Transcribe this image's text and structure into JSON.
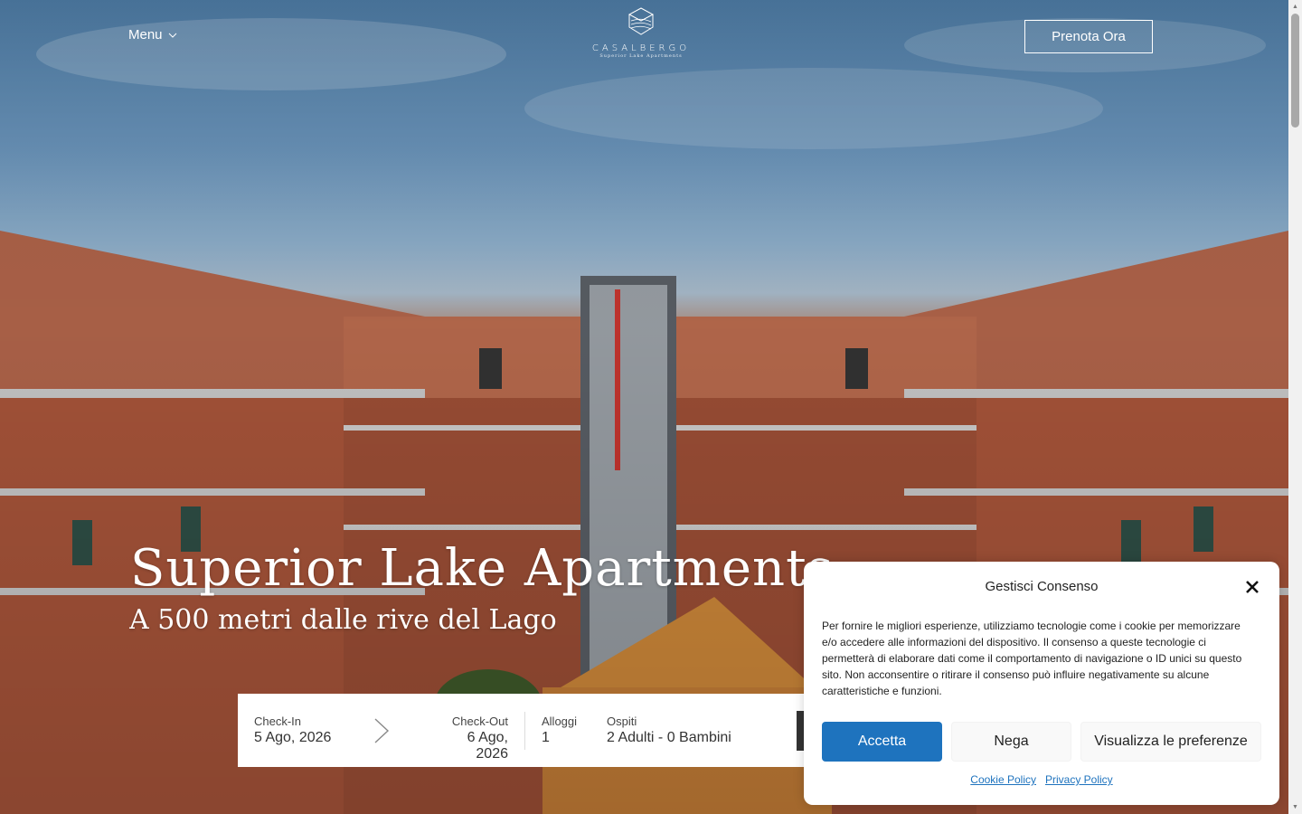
{
  "header": {
    "menu_label": "Menu",
    "logo_name": "CASALBERGO",
    "logo_tagline": "Superior Lake Apartments",
    "book_label": "Prenota Ora"
  },
  "hero": {
    "title": "Superior Lake Apartments",
    "subtitle": "A 500 metri dalle rive del Lago"
  },
  "booking": {
    "checkin_label": "Check-In",
    "checkin_value": "5 Ago, 2026",
    "checkout_label": "Check-Out",
    "checkout_value": "6 Ago, 2026",
    "rooms_label": "Alloggi",
    "rooms_value": "1",
    "guests_label": "Ospiti",
    "guests_value": "2 Adulti - 0 Bambini"
  },
  "cookie_dialog": {
    "title": "Gestisci Consenso",
    "body": "Per fornire le migliori esperienze, utilizziamo tecnologie come i cookie per memorizzare e/o accedere alle informazioni del dispositivo. Il consenso a queste tecnologie ci permetterà di elaborare dati come il comportamento di navigazione o ID unici su questo sito. Non acconsentire o ritirare il consenso può influire negativamente su alcune caratteristiche e funzioni.",
    "accept_label": "Accetta",
    "deny_label": "Nega",
    "prefs_label": "Visualizza le preferenze",
    "cookie_policy_label": "Cookie Policy",
    "privacy_policy_label": "Privacy Policy"
  },
  "colors": {
    "accent": "#1e73be",
    "dialog_bg": "#ffffff",
    "hero_text": "#ffffff"
  },
  "icons": {
    "menu": "chevron-down-icon",
    "close": "close-icon",
    "date_arrow": "chevron-right-icon",
    "logo": "layered-cube-logo-icon"
  }
}
